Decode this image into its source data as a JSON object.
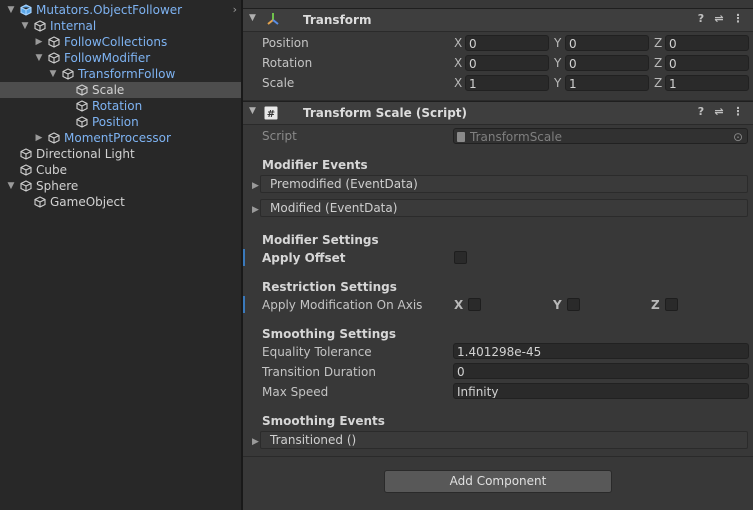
{
  "hierarchy": {
    "items": [
      {
        "label": "Mutators.ObjectFollower",
        "arrow": "▼",
        "color": "blue",
        "icon": "prefab-cube-icon"
      },
      {
        "label": "Internal",
        "arrow": "▼",
        "color": "blue",
        "icon": "cube-icon"
      },
      {
        "label": "FollowCollections",
        "arrow": "▶",
        "color": "blue",
        "icon": "cube-icon"
      },
      {
        "label": "FollowModifier",
        "arrow": "▼",
        "color": "blue",
        "icon": "cube-icon"
      },
      {
        "label": "TransformFollow",
        "arrow": "▼",
        "color": "blue",
        "icon": "cube-icon"
      },
      {
        "label": "Scale",
        "arrow": "",
        "color": "white",
        "icon": "cube-icon"
      },
      {
        "label": "Rotation",
        "arrow": "",
        "color": "blue",
        "icon": "cube-icon"
      },
      {
        "label": "Position",
        "arrow": "",
        "color": "blue",
        "icon": "cube-icon"
      },
      {
        "label": "MomentProcessor",
        "arrow": "▶",
        "color": "blue",
        "icon": "cube-icon"
      },
      {
        "label": "Directional Light",
        "arrow": "",
        "color": "white",
        "icon": "cube-icon"
      },
      {
        "label": "Cube",
        "arrow": "",
        "color": "white",
        "icon": "cube-icon"
      },
      {
        "label": "Sphere",
        "arrow": "▼",
        "color": "white",
        "icon": "cube-icon"
      },
      {
        "label": "GameObject",
        "arrow": "",
        "color": "white",
        "icon": "cube-icon"
      }
    ],
    "expand_icon": "chevron-right-icon"
  },
  "transform": {
    "title": "Transform",
    "rows": [
      {
        "label": "Position",
        "x": "0",
        "y": "0",
        "z": "0"
      },
      {
        "label": "Rotation",
        "x": "0",
        "y": "0",
        "z": "0"
      },
      {
        "label": "Scale",
        "x": "1",
        "y": "1",
        "z": "1"
      }
    ],
    "axis": {
      "x": "X",
      "y": "Y",
      "z": "Z"
    }
  },
  "script_comp": {
    "title": "Transform Scale (Script)",
    "script_label": "Script",
    "script_value": "TransformScale",
    "modifier_events": {
      "heading": "Modifier Events",
      "premodified": "Premodified (EventData)",
      "modified": "Modified (EventData)"
    },
    "modifier_settings": {
      "heading": "Modifier Settings",
      "apply_offset": "Apply Offset"
    },
    "restriction": {
      "heading": "Restriction Settings",
      "apply_axis": "Apply Modification On Axis",
      "x": "X",
      "y": "Y",
      "z": "Z"
    },
    "smoothing": {
      "heading": "Smoothing Settings",
      "equality_label": "Equality Tolerance",
      "equality_value": "1.401298e-45",
      "transition_label": "Transition Duration",
      "transition_value": "0",
      "maxspeed_label": "Max Speed",
      "maxspeed_value": "Infinity"
    },
    "smoothing_events": {
      "heading": "Smoothing Events",
      "transitioned": "Transitioned ()"
    }
  },
  "add_component": "Add Component",
  "header_buttons": {
    "help": "?",
    "settings": "⇌",
    "menu": "⋮"
  },
  "colors": {
    "accent": "#3a79bb",
    "prefab_blue": "#7eb3f2"
  }
}
